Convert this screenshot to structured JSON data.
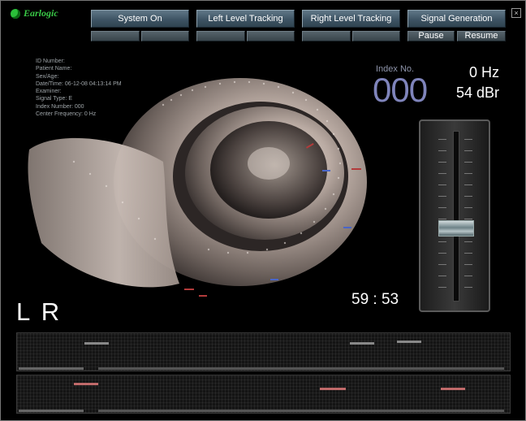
{
  "app": {
    "logo_text": "Earlogic",
    "close_glyph": "×"
  },
  "toolbar": {
    "system_on": "System On",
    "left_level_tracking": "Left Level Tracking",
    "right_level_tracking": "Right Level Tracking",
    "signal_generation": "Signal Generation",
    "pause": "Pause",
    "resume": "Resume"
  },
  "patient": {
    "id_number": "ID Number:",
    "patient_name": "Patient Name:",
    "sex_age": "Sex/Age:",
    "datetime": "Date/Time: 06-12-08 04:13:14 PM",
    "examiner": "Examiner:",
    "signal_type": "Signal Type: E",
    "index_number": "Index Number: 000",
    "center_frequency": "Center Frequency: 0 Hz"
  },
  "readout": {
    "index_label": "Index No.",
    "index_value": "000",
    "frequency": "0 Hz",
    "level": "54 dBr",
    "level_fraction": 0.42
  },
  "timer": "59 : 53",
  "channels_label": "L R",
  "colors": {
    "left_mark": "#b23b3b",
    "right_mark": "#4a66c8",
    "track_mark_top": "#888888",
    "track_mark_bottom": "#c06a6a"
  }
}
